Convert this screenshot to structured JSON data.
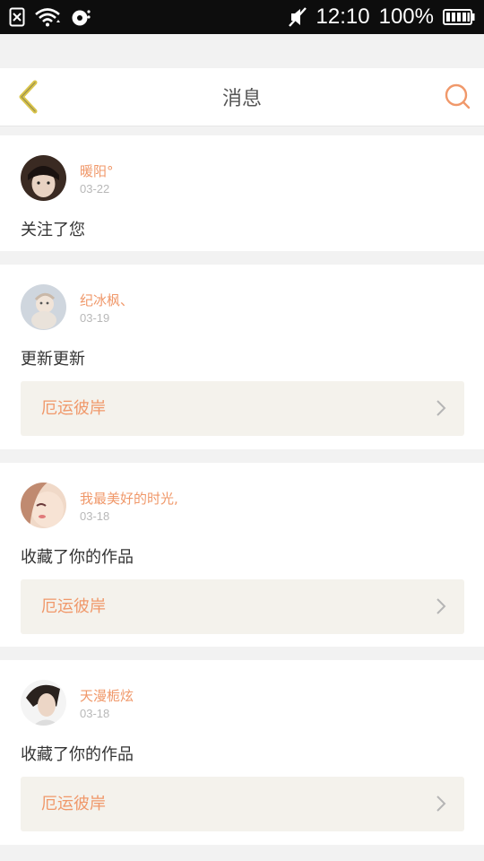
{
  "status_bar": {
    "time": "12:10",
    "battery_percent": "100%",
    "icons": [
      "sim-error-icon",
      "wifi-icon",
      "sync-icon",
      "mute-icon",
      "battery-icon"
    ]
  },
  "header": {
    "title": "消息",
    "accent_color": "#f0986a"
  },
  "messages": [
    {
      "username": "暖阳°",
      "date": "03-22",
      "text": "关注了您",
      "link": null
    },
    {
      "username": "纪冰枫、",
      "date": "03-19",
      "text": "更新更新",
      "link": "厄运彼岸"
    },
    {
      "username": "我最美好的时光,",
      "date": "03-18",
      "text": "收藏了你的作品",
      "link": "厄运彼岸"
    },
    {
      "username": "天漫栀炫",
      "date": "03-18",
      "text": "收藏了你的作品",
      "link": "厄运彼岸"
    }
  ]
}
